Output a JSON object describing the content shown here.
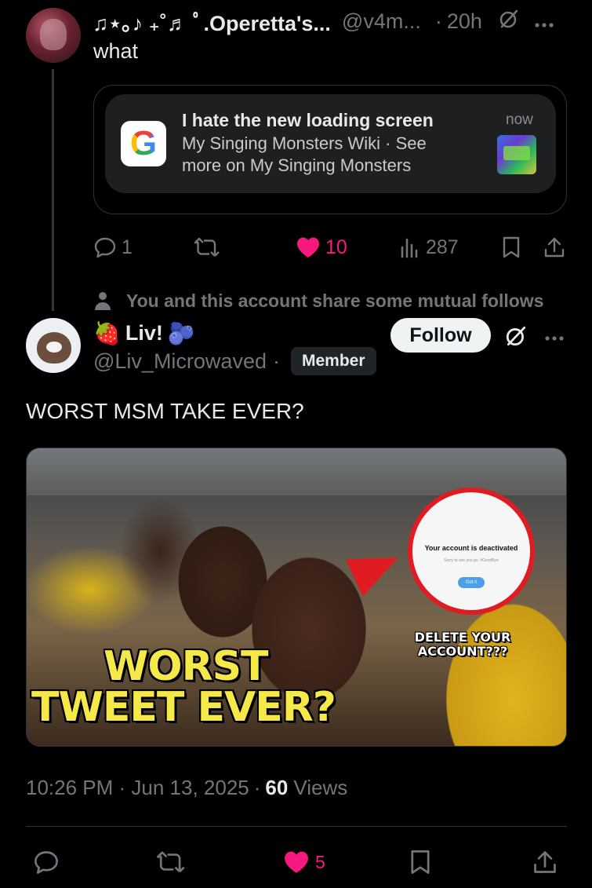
{
  "reply": {
    "display_name": "♫⋆｡♪ ₊˚♬ ﾟ.Operetta's...",
    "handle": "@v4m...",
    "separator": "·",
    "time": "20h",
    "text": "what",
    "card": {
      "app_icon": "google-logo",
      "app_letter": "G",
      "title": "I hate the new loading screen",
      "body": "My Singing Monsters Wiki · See more on My Singing Monsters",
      "time": "now"
    },
    "stats": {
      "replies": "1",
      "reposts": "",
      "likes": "10",
      "views": "287"
    }
  },
  "mutual_follows": "You and this account share some mutual follows",
  "tweet": {
    "display_name": "Liv!",
    "emoji_left": "🍓",
    "emoji_right": "🫐",
    "handle": "@Liv_Microwaved",
    "separator": "·",
    "badge": "Member",
    "follow_label": "Follow",
    "text": "WORST MSM TAKE EVER?",
    "media": {
      "big_line1": "WORST",
      "big_line2": "TWEET EVER?",
      "small_text": "DELETE YOUR ACCOUNT???",
      "popup_title": "Your account is deactivated",
      "popup_sub": "Sorry to see you go. #GoodBye",
      "popup_button": "Got it"
    },
    "timestamp": "10:26 PM · Jun 13, 2025",
    "meta_sep": "·",
    "views_count": "60",
    "views_label": "Views",
    "stats": {
      "likes": "5"
    }
  },
  "colors": {
    "background": "#000000",
    "text": "#e7e9ea",
    "muted": "#71767b",
    "like": "#f91880",
    "border": "#2f3336"
  }
}
